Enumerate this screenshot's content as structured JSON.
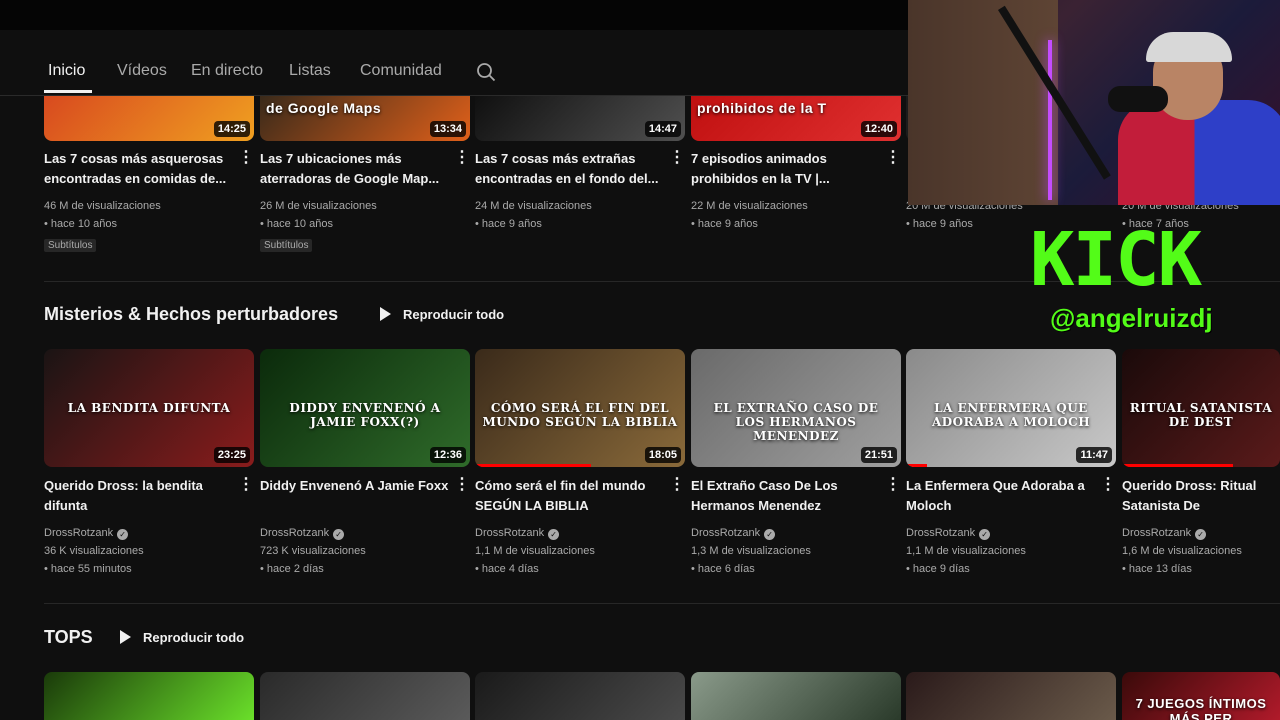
{
  "nav": {
    "tabs": [
      {
        "label": "Inicio"
      },
      {
        "label": "Vídeos"
      },
      {
        "label": "En directo"
      },
      {
        "label": "Listas"
      },
      {
        "label": "Comunidad"
      }
    ]
  },
  "top_row": [
    {
      "title": "Las 7 cosas más asquerosas encontradas en comidas de...",
      "duration": "14:25",
      "views": "46 M de visualizaciones",
      "age": "• hace 10 años",
      "chip": "Subtítulos",
      "colors": [
        "#d84a1f",
        "#f0a020"
      ]
    },
    {
      "title": "Las 7 ubicaciones más aterradoras de Google Map...",
      "duration": "13:34",
      "thumb_text": "de Google Maps",
      "views": "26 M de visualizaciones",
      "age": "• hace 10 años",
      "chip": "Subtítulos",
      "colors": [
        "#3a2a1a",
        "#e0601a"
      ]
    },
    {
      "title": "Las 7 cosas más extrañas encontradas en el fondo del...",
      "duration": "14:47",
      "views": "24 M de visualizaciones",
      "age": "• hace 9 años",
      "chip": "",
      "colors": [
        "#101010",
        "#505050"
      ]
    },
    {
      "title": "7 episodios animados prohibidos en la TV |...",
      "duration": "12:40",
      "thumb_text": "prohibidos de la T",
      "views": "22 M de visualizaciones",
      "age": "• hace 9 años",
      "chip": "",
      "colors": [
        "#c01010",
        "#e03030"
      ]
    },
    {
      "title": "",
      "duration": "",
      "views": "20 M de visualizaciones",
      "age": "• hace 9 años",
      "chip": "",
      "colors": [
        "#1a1a1a",
        "#2a2a2a"
      ]
    },
    {
      "title": "",
      "duration": "",
      "views": "20 M de visualizaciones",
      "age": "• hace 7 años",
      "chip": "",
      "colors": [
        "#1a1a1a",
        "#2a2a2a"
      ]
    }
  ],
  "shelf_misterios": {
    "title": "Misterios & Hechos perturbadores",
    "play_all": "Reproducir todo",
    "videos": [
      {
        "title": "Querido Dross: la bendita difunta",
        "thumb_text": "LA BENDITA DIFUNTA",
        "duration": "23:25",
        "channel": "DrossRotzank",
        "views": "36 K visualizaciones",
        "age": "• hace 55 minutos",
        "progress": 0,
        "colors": [
          "#1a1414",
          "#8a1c1c"
        ]
      },
      {
        "title": "Diddy Envenenó A Jamie Foxx",
        "thumb_text": "DIDDY ENVENENÓ A JAMIE FOXX(?)",
        "duration": "12:36",
        "channel": "DrossRotzank",
        "views": "723 K visualizaciones",
        "age": "• hace 2 días",
        "progress": 0,
        "colors": [
          "#0b2a0b",
          "#2f6b2a"
        ]
      },
      {
        "title": "Cómo será el fin del mundo SEGÚN LA BIBLIA",
        "thumb_text": "CÓMO SERÁ EL FIN DEL MUNDO SEGÚN LA BIBLIA",
        "duration": "18:05",
        "channel": "DrossRotzank",
        "views": "1,1 M de visualizaciones",
        "age": "• hace 4 días",
        "progress": 0.55,
        "colors": [
          "#3a2a1a",
          "#8a6a3a"
        ]
      },
      {
        "title": "El Extraño Caso De Los Hermanos Menendez",
        "thumb_text": "EL EXTRAÑO CASO DE LOS HERMANOS MENENDEZ",
        "duration": "21:51",
        "channel": "DrossRotzank",
        "views": "1,3 M de visualizaciones",
        "age": "• hace 6 días",
        "progress": 0,
        "colors": [
          "#6a6a6a",
          "#a0a0a0"
        ]
      },
      {
        "title": "La Enfermera Que Adoraba a Moloch",
        "thumb_text": "LA ENFERMERA QUE ADORABA A MOLOCH",
        "duration": "11:47",
        "channel": "DrossRotzank",
        "views": "1,1 M de visualizaciones",
        "age": "• hace 9 días",
        "progress": 0.1,
        "colors": [
          "#8a8a8a",
          "#c8c8c8"
        ]
      },
      {
        "title": "Querido Dross: Ritual Satanista De Destrucción",
        "thumb_text": "RITUAL SATANISTA DE DEST",
        "duration": "",
        "channel": "DrossRotzank",
        "views": "1,6 M de visualizaciones",
        "age": "• hace 13 días",
        "progress": 0.7,
        "colors": [
          "#1a0a0a",
          "#5a1a1a"
        ]
      }
    ]
  },
  "shelf_tops": {
    "title": "TOPS",
    "play_all": "Reproducir todo",
    "thumbs": [
      {
        "colors": [
          "#1a3a0a",
          "#6adf2a"
        ],
        "text": ""
      },
      {
        "colors": [
          "#2a2a2a",
          "#5a5a5a"
        ],
        "text": ""
      },
      {
        "colors": [
          "#1a1a1a",
          "#4a4a4a"
        ],
        "text": ""
      },
      {
        "colors": [
          "#8a9a8a",
          "#2a3a2a"
        ],
        "text": ""
      },
      {
        "colors": [
          "#2a1a1a",
          "#6a5a4a"
        ],
        "text": ""
      },
      {
        "colors": [
          "#3a0a0a",
          "#b01a2a"
        ],
        "text": "7 JUEGOS ÍNTIMOS MÁS PER"
      }
    ]
  },
  "overlay": {
    "kick_logo": "KICK",
    "kick_handle": "@angelruizdj",
    "kick_color": "#53fc18"
  }
}
